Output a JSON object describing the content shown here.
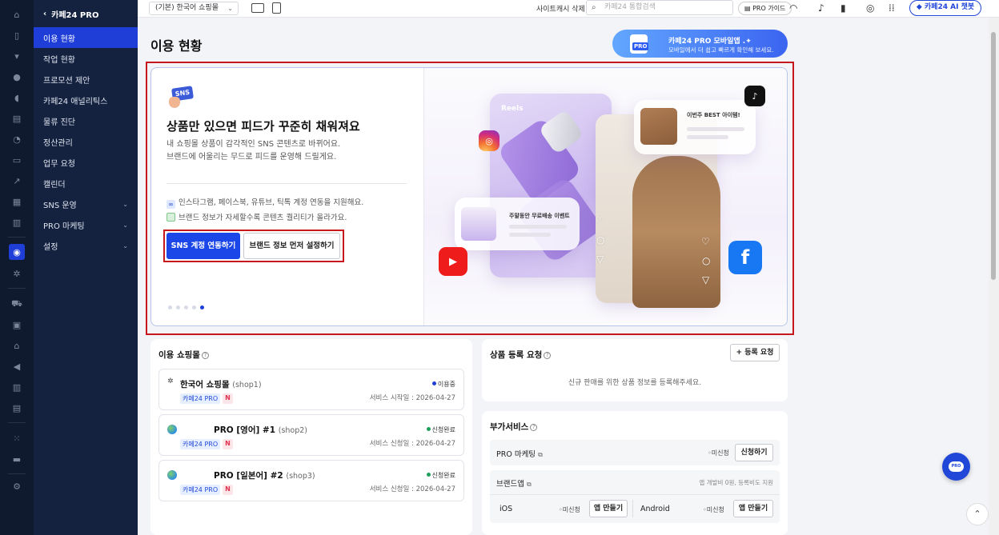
{
  "topbar": {
    "shop_select": "(기본) 한국어 쇼핑몰",
    "cache_delete": "사이트캐시 삭제",
    "search_placeholder": "카페24 통합검색",
    "pro_guide": "PRO 가이드",
    "ai_chatbot": "카페24 AI 챗봇"
  },
  "sidebar": {
    "header": "카페24 PRO",
    "items": [
      {
        "label": "이용 현황",
        "active": true
      },
      {
        "label": "작업 현황"
      },
      {
        "label": "프로모션 제안"
      },
      {
        "label": "카페24 애널리틱스"
      },
      {
        "label": "물류 진단"
      },
      {
        "label": "정산관리"
      },
      {
        "label": "업무 요청"
      },
      {
        "label": "캘린더"
      },
      {
        "label": "SNS 운영",
        "expandable": true
      },
      {
        "label": "PRO 마케팅",
        "expandable": true
      },
      {
        "label": "설정",
        "expandable": true
      }
    ]
  },
  "page": {
    "title": "이용 현황",
    "promo_title": "카페24 PRO 모바일앱 .✦",
    "promo_sub": "모바일에서 더 쉽고 빠르게 확인해 보세요.",
    "promo_icon_label": "PRO"
  },
  "banner": {
    "badge": "SNS",
    "title": "상품만 있으면 피드가 꾸준히 채워져요",
    "desc1": "내 쇼핑몰 상품이 감각적인 SNS 콘텐츠로 바뀌어요.",
    "desc2": "브랜드에 어울리는 무드로 피드를 운영해 드릴게요.",
    "point1": "인스타그램, 페이스북, 유튜브, 틱톡 계정 연동을 지원해요.",
    "point2": "브랜드 정보가 자세할수록 콘텐츠 퀄리티가 올라가요.",
    "btn_primary": "SNS 계정 연동하기",
    "btn_secondary": "브랜드 정보 먼저 설정하기",
    "slide_count": 5,
    "active_slide": 5,
    "illustration": {
      "reels_label": "Reels",
      "best_label": "이번주 BEST 아이템!",
      "free_label": "주말동안 무료배송 이벤트"
    }
  },
  "shops": {
    "title": "이용 쇼핑몰",
    "items": [
      {
        "name": "한국어 쇼핑몰",
        "id": "(shop1)",
        "tag": "카페24 PRO",
        "n": "N",
        "status": "이용중",
        "status_color": "#1f3ed8",
        "date": "서비스 시작일 : 2026-04-27"
      },
      {
        "name": "PRO [영어] #1",
        "id": "(shop2)",
        "tag": "카페24 PRO",
        "n": "N",
        "status": "신청완료",
        "status_color": "#1ea05a",
        "date": "서비스 신청일 : 2026-04-27"
      },
      {
        "name": "PRO [일본어] #2",
        "id": "(shop3)",
        "tag": "카페24 PRO",
        "n": "N",
        "status": "신청완료",
        "status_color": "#1ea05a",
        "date": "서비스 신청일 : 2026-04-27"
      }
    ]
  },
  "product_request": {
    "title": "상품 등록 요청",
    "button": "+ 등록 요청",
    "empty": "신규 판매를 위한 상품 정보를 등록해주세요."
  },
  "addons": {
    "title": "부가서비스",
    "pro_marketing": {
      "label": "PRO 마케팅",
      "status": "미신청",
      "button": "신청하기"
    },
    "brand_app": {
      "label": "브랜드앱",
      "note": "앱 개발비 0원, 등록비도 지원"
    },
    "ios": {
      "label": "iOS",
      "status": "미신청",
      "button": "앱 만들기"
    },
    "android": {
      "label": "Android",
      "status": "미신청",
      "button": "앱 만들기"
    }
  },
  "fab_label": "PRO"
}
